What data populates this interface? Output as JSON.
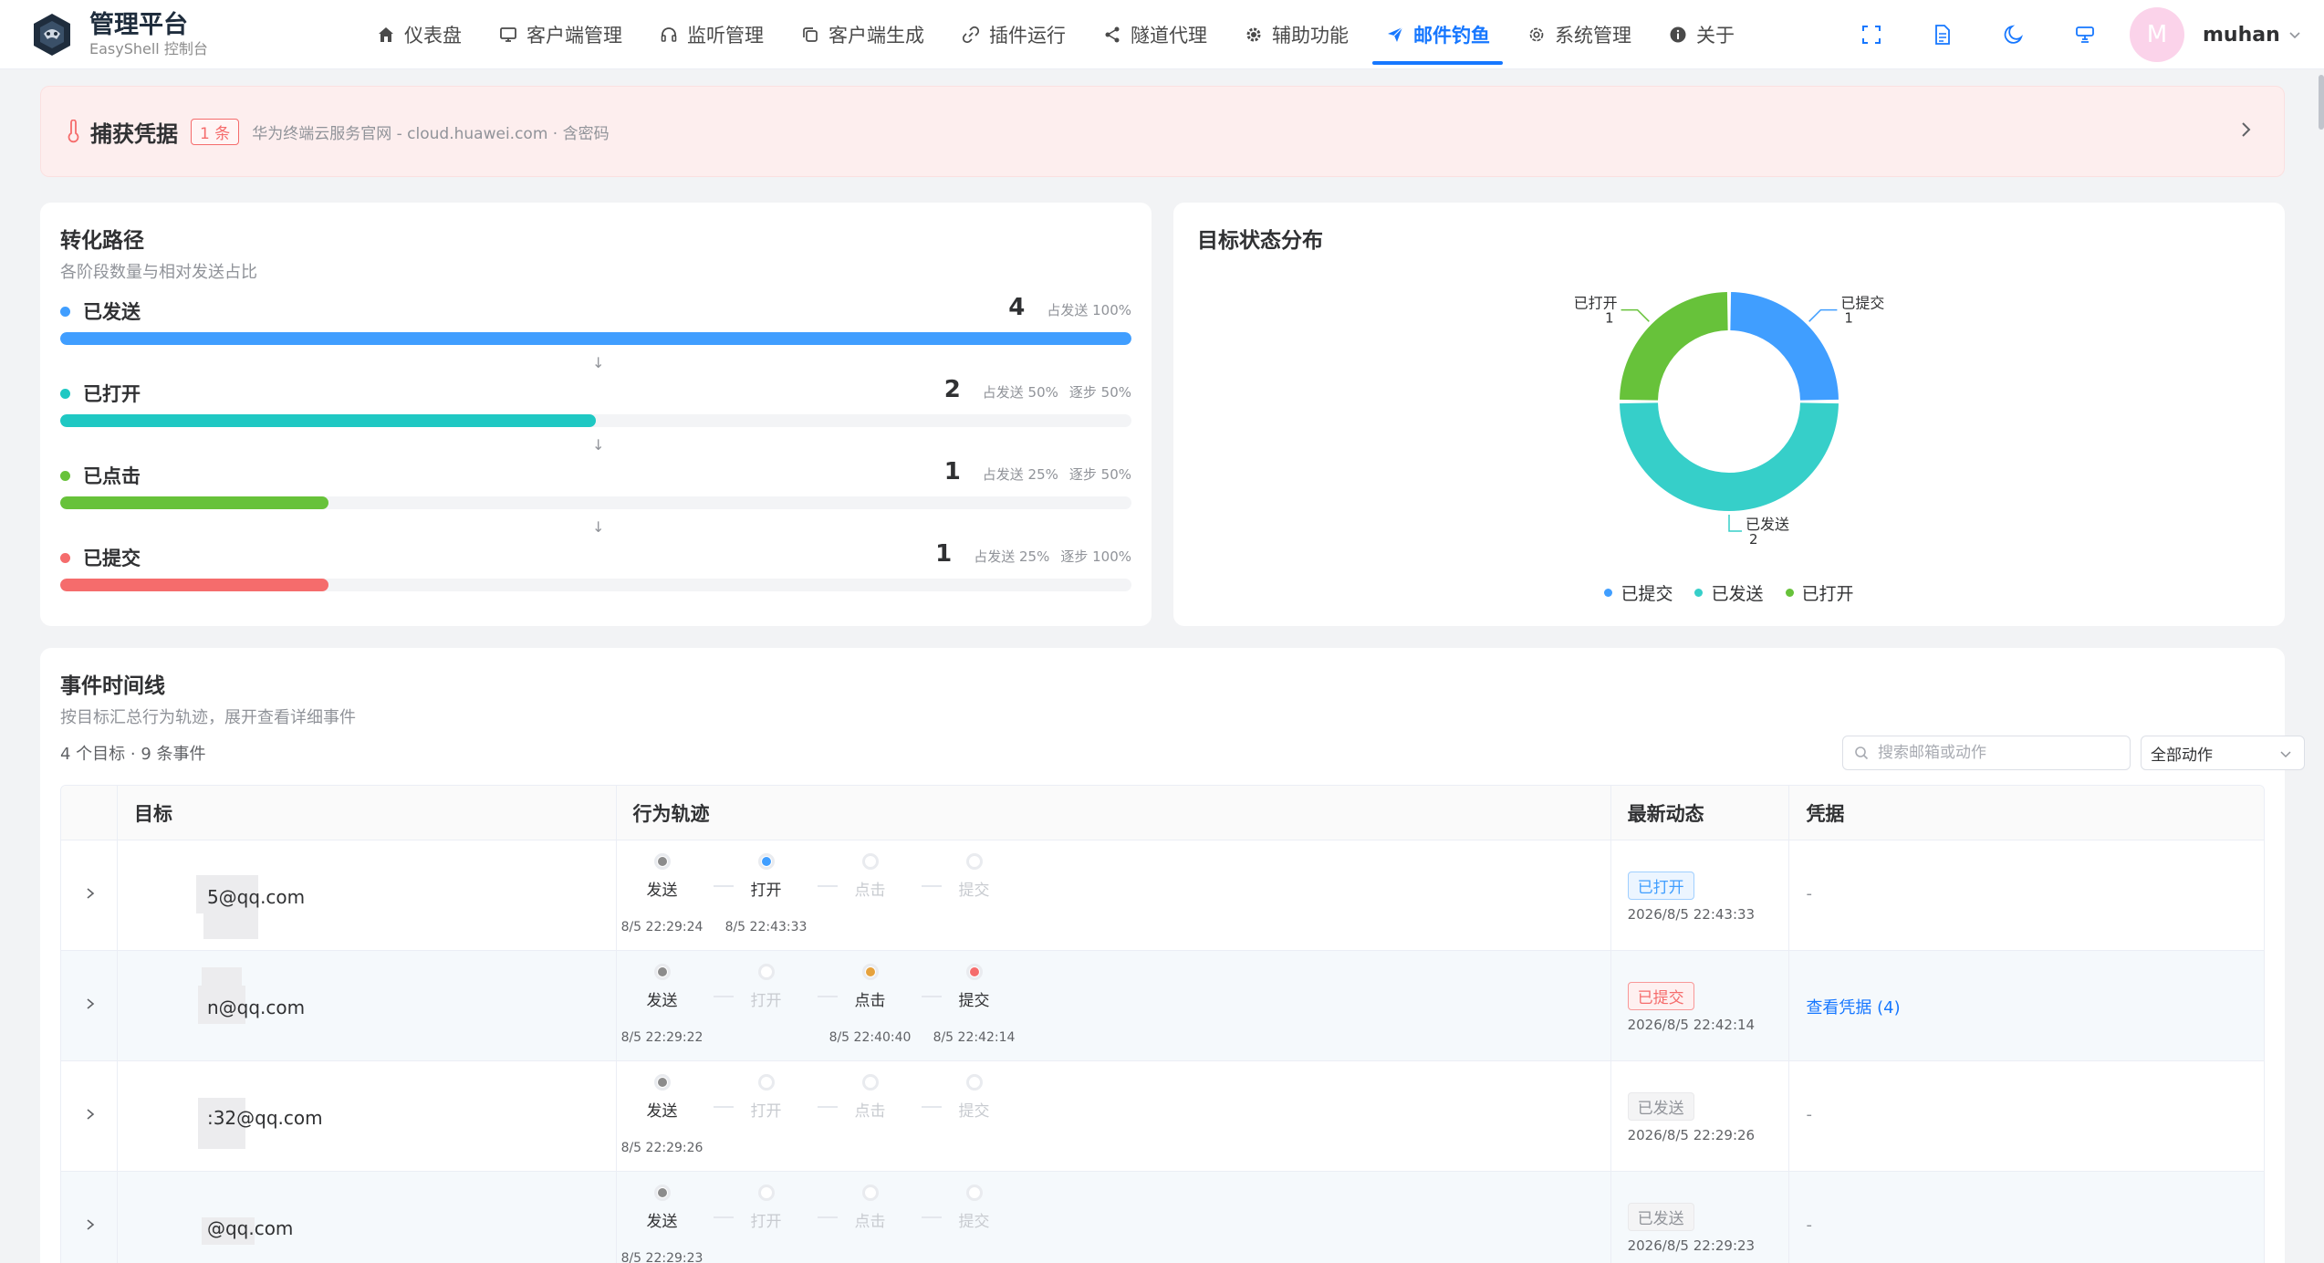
{
  "brand": {
    "title": "管理平台",
    "subtitle": "EasyShell 控制台"
  },
  "nav": [
    {
      "label": "仪表盘",
      "icon": "home-icon"
    },
    {
      "label": "客户端管理",
      "icon": "monitor-icon"
    },
    {
      "label": "监听管理",
      "icon": "headset-icon"
    },
    {
      "label": "客户端生成",
      "icon": "copy-icon"
    },
    {
      "label": "插件运行",
      "icon": "link-icon"
    },
    {
      "label": "隧道代理",
      "icon": "share-icon"
    },
    {
      "label": "辅助功能",
      "icon": "gear-icon"
    },
    {
      "label": "邮件钓鱼",
      "icon": "send-icon",
      "active": true
    },
    {
      "label": "系统管理",
      "icon": "settings-icon"
    },
    {
      "label": "关于",
      "icon": "info-icon"
    }
  ],
  "user": {
    "avatar": "M",
    "name": "muhan"
  },
  "banner": {
    "title": "捕获凭据",
    "badge": "1 条",
    "desc": "华为终端云服务官网 - cloud.huawei.com · 含密码"
  },
  "funnel": {
    "title": "转化路径",
    "subtitle": "各阶段数量与相对发送占比",
    "stages": [
      {
        "label": "已发送",
        "count": "4",
        "pct": "占发送 100%",
        "step": "",
        "fraction": 1.0,
        "color": "#409eff"
      },
      {
        "label": "已打开",
        "count": "2",
        "pct": "占发送 50%",
        "step": "逐步 50%",
        "fraction": 0.5,
        "color": "#1fc8c3"
      },
      {
        "label": "已点击",
        "count": "1",
        "pct": "占发送 25%",
        "step": "逐步 50%",
        "fraction": 0.25,
        "color": "#67c23a"
      },
      {
        "label": "已提交",
        "count": "1",
        "pct": "占发送 25%",
        "step": "逐步 100%",
        "fraction": 0.25,
        "color": "#f56c6c"
      }
    ],
    "arrow": "↓"
  },
  "donut": {
    "title": "目标状态分布",
    "legend": [
      {
        "label": "已提交",
        "color": "#409eff"
      },
      {
        "label": "已发送",
        "color": "#36cfc9"
      },
      {
        "label": "已打开",
        "color": "#67c23a"
      }
    ],
    "labels": {
      "submitted": {
        "name": "已提交",
        "value": "1"
      },
      "sent": {
        "name": "已发送",
        "value": "2"
      },
      "opened": {
        "name": "已打开",
        "value": "1"
      }
    }
  },
  "chart_data": {
    "type": "pie",
    "categories": [
      "已提交",
      "已发送",
      "已打开"
    ],
    "values": [
      1,
      2,
      1
    ],
    "colors": [
      "#409eff",
      "#36cfc9",
      "#67c23a"
    ],
    "title": "目标状态分布",
    "legend": "bottom"
  },
  "timeline": {
    "title": "事件时间线",
    "subtitle": "按目标汇总行为轨迹，展开查看详细事件",
    "summary": "4 个目标 · 9 条事件",
    "search_placeholder": "搜索邮箱或动作",
    "filter": "全部动作",
    "columns": [
      "目标",
      "行为轨迹",
      "最新动态",
      "凭据"
    ],
    "rows": [
      {
        "email": "5@qq.com",
        "steps": [
          {
            "label": "发送",
            "time": "8/5 22:29:24",
            "on": true,
            "color": "#8c8c8c"
          },
          {
            "label": "打开",
            "time": "8/5 22:43:33",
            "on": true,
            "color": "#409eff"
          },
          {
            "label": "点击",
            "time": "",
            "on": false,
            "color": ""
          },
          {
            "label": "提交",
            "time": "",
            "on": false,
            "color": ""
          }
        ],
        "status": "已打开",
        "status_kind": "open",
        "status_time": "2026/8/5 22:43:33",
        "cred": "-"
      },
      {
        "email": "n@qq.com",
        "steps": [
          {
            "label": "发送",
            "time": "8/5 22:29:22",
            "on": true,
            "color": "#8c8c8c"
          },
          {
            "label": "打开",
            "time": "",
            "on": false,
            "color": ""
          },
          {
            "label": "点击",
            "time": "8/5 22:40:40",
            "on": true,
            "color": "#e6a23c"
          },
          {
            "label": "提交",
            "time": "8/5 22:42:14",
            "on": true,
            "color": "#f56c6c"
          }
        ],
        "status": "已提交",
        "status_kind": "submit",
        "status_time": "2026/8/5 22:42:14",
        "cred": "查看凭据 (4)"
      },
      {
        "email": ":32@qq.com",
        "steps": [
          {
            "label": "发送",
            "time": "8/5 22:29:26",
            "on": true,
            "color": "#8c8c8c"
          },
          {
            "label": "打开",
            "time": "",
            "on": false,
            "color": ""
          },
          {
            "label": "点击",
            "time": "",
            "on": false,
            "color": ""
          },
          {
            "label": "提交",
            "time": "",
            "on": false,
            "color": ""
          }
        ],
        "status": "已发送",
        "status_kind": "sent",
        "status_time": "2026/8/5 22:29:26",
        "cred": "-"
      },
      {
        "email": "@qq.com",
        "steps": [
          {
            "label": "发送",
            "time": "8/5 22:29:23",
            "on": true,
            "color": "#8c8c8c"
          },
          {
            "label": "打开",
            "time": "",
            "on": false,
            "color": ""
          },
          {
            "label": "点击",
            "time": "",
            "on": false,
            "color": ""
          },
          {
            "label": "提交",
            "time": "",
            "on": false,
            "color": ""
          }
        ],
        "status": "已发送",
        "status_kind": "sent",
        "status_time": "2026/8/5 22:29:23",
        "cred": "-"
      }
    ]
  }
}
